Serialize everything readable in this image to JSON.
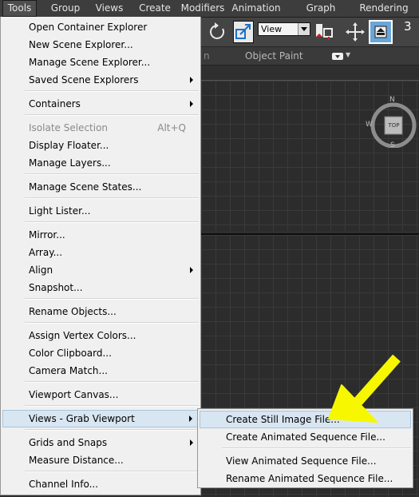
{
  "menubar": {
    "items": [
      {
        "label": "Tools"
      },
      {
        "label": "Group"
      },
      {
        "label": "Views"
      },
      {
        "label": "Create"
      },
      {
        "label": "Modifiers"
      },
      {
        "label": "Animation"
      },
      {
        "label": "Graph Editors"
      },
      {
        "label": "Rendering"
      }
    ]
  },
  "toolbar": {
    "view_select_value": "View",
    "count_label": "3"
  },
  "ribbon": {
    "truncated_label": "n",
    "object_paint_label": "Object Paint",
    "arrow_glyph": "▼"
  },
  "viewport": {
    "viewcube_face": "TOP",
    "compass_n": "N",
    "compass_w": "W",
    "compass_s": "S"
  },
  "tools_menu": {
    "items": [
      {
        "label": "Open Container Explorer"
      },
      {
        "label": "New Scene Explorer..."
      },
      {
        "label": "Manage Scene Explorer..."
      },
      {
        "label": "Saved Scene Explorers"
      },
      {
        "label": "Containers"
      },
      {
        "label": "Isolate Selection",
        "shortcut": "Alt+Q"
      },
      {
        "label": "Display Floater..."
      },
      {
        "label": "Manage Layers..."
      },
      {
        "label": "Manage Scene States..."
      },
      {
        "label": "Light Lister..."
      },
      {
        "label": "Mirror..."
      },
      {
        "label": "Array..."
      },
      {
        "label": "Align"
      },
      {
        "label": "Snapshot..."
      },
      {
        "label": "Rename Objects..."
      },
      {
        "label": "Assign Vertex Colors..."
      },
      {
        "label": "Color Clipboard..."
      },
      {
        "label": "Camera Match..."
      },
      {
        "label": "Viewport Canvas..."
      },
      {
        "label": "Views - Grab Viewport"
      },
      {
        "label": "Grids and Snaps"
      },
      {
        "label": "Measure Distance..."
      },
      {
        "label": "Channel Info..."
      }
    ]
  },
  "sub_menu": {
    "items": [
      {
        "label": "Create Still Image File..."
      },
      {
        "label": "Create Animated Sequence File..."
      },
      {
        "label": "View Animated Sequence File..."
      },
      {
        "label": "Rename Animated Sequence File..."
      }
    ]
  },
  "colors": {
    "menu_bg": "#f0f0f0",
    "highlight": "#d8e6f2",
    "annotation_arrow": "#f7f700"
  }
}
